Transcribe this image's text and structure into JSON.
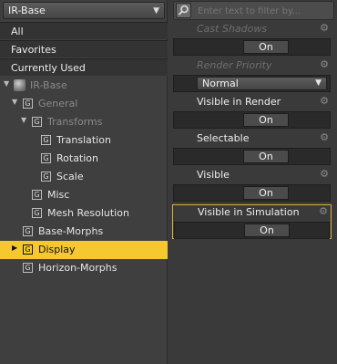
{
  "left": {
    "dropdown": {
      "value": "IR-Base",
      "icon": "chevron-down-icon"
    },
    "categories": [
      "All",
      "Favorites",
      "Currently Used"
    ],
    "tree": [
      {
        "label": "IR-Base",
        "icon": "figure-icon"
      },
      {
        "label": "General",
        "icon": "group-icon"
      },
      {
        "label": "Transforms",
        "icon": "group-icon"
      },
      {
        "label": "Translation",
        "icon": "group-icon"
      },
      {
        "label": "Rotation",
        "icon": "group-icon"
      },
      {
        "label": "Scale",
        "icon": "group-icon"
      },
      {
        "label": "Misc",
        "icon": "group-icon"
      },
      {
        "label": "Mesh Resolution",
        "icon": "group-icon"
      },
      {
        "label": "Base-Morphs",
        "icon": "group-icon"
      },
      {
        "label": "Display",
        "icon": "group-icon"
      },
      {
        "label": "Horizon-Morphs",
        "icon": "group-icon"
      }
    ],
    "selected": "Display",
    "accent": "#f5c830"
  },
  "right": {
    "filter_placeholder": "Enter text to filter by...",
    "properties": [
      {
        "name": "Cast Shadows",
        "value": "On"
      },
      {
        "name": "Render Priority",
        "value": "Normal"
      },
      {
        "name": "Visible in Render",
        "value": "On"
      },
      {
        "name": "Selectable",
        "value": "On"
      },
      {
        "name": "Visible",
        "value": "On"
      },
      {
        "name": "Visible in Simulation",
        "value": "On"
      }
    ]
  }
}
